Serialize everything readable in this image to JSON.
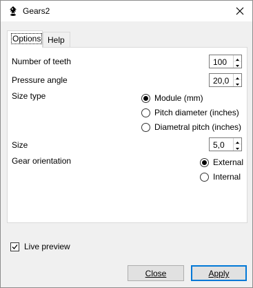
{
  "window": {
    "title": "Gears2"
  },
  "tabs": [
    {
      "label": "Options",
      "active": true
    },
    {
      "label": "Help",
      "active": false
    }
  ],
  "fields": {
    "teeth": {
      "label": "Number of teeth",
      "value": "100"
    },
    "pressure": {
      "label": "Pressure angle",
      "value": "20,0"
    },
    "size_type": {
      "label": "Size type",
      "options": [
        "Module (mm)",
        "Pitch diameter (inches)",
        "Diametral pitch (inches)"
      ],
      "selected": "Module (mm)"
    },
    "size": {
      "label": "Size",
      "value": "5,0"
    },
    "orientation": {
      "label": "Gear orientation",
      "options": [
        "External",
        "Internal"
      ],
      "selected": "External"
    }
  },
  "live_preview": {
    "label": "Live preview",
    "checked": true
  },
  "buttons": {
    "close": "Close",
    "apply": "Apply"
  },
  "icons": {
    "app": "inkscape-icon",
    "close": "close-icon"
  },
  "colors": {
    "accent": "#0078d7",
    "panel": "#ffffff",
    "window": "#f0f0f0"
  }
}
